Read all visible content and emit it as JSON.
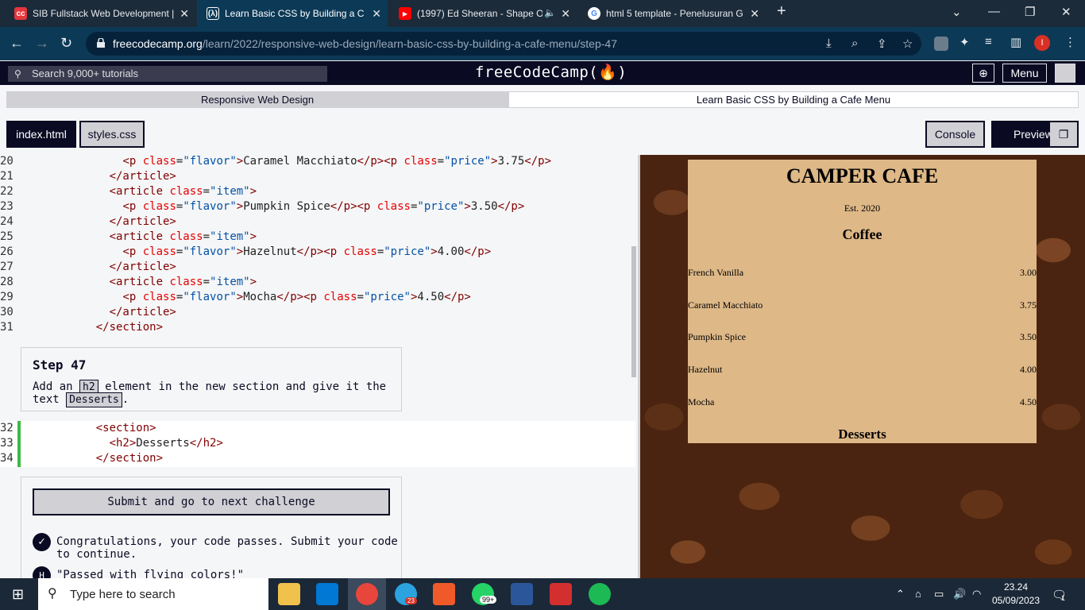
{
  "browser": {
    "tabs": [
      {
        "label": "SIB Fullstack Web Development |",
        "icon": "fcc-red-icon"
      },
      {
        "label": "Learn Basic CSS by Building a Caf",
        "icon": "fcc-icon",
        "active": true
      },
      {
        "label": "(1997) Ed Sheeran - Shape O",
        "icon": "youtube-icon"
      },
      {
        "label": "html 5 template - Penelusuran G",
        "icon": "google-icon"
      }
    ],
    "new_tab": "+",
    "url_host": "freecodecamp.org",
    "url_path": "/learn/2022/responsive-web-design/learn-basic-css-by-building-a-cafe-menu/step-47",
    "profile_initial": "I"
  },
  "fcc": {
    "search_placeholder": "Search 9,000+ tutorials",
    "logo": "freeCodeCamp(🔥)",
    "menu_label": "Menu"
  },
  "breadcrumb": {
    "superblock": "Responsive Web Design",
    "block": "Learn Basic CSS by Building a Cafe Menu"
  },
  "editor_tabs": {
    "index": "index.html",
    "styles": "styles.css",
    "console": "Console",
    "preview": "Preview"
  },
  "code_lines": [
    {
      "n": "20",
      "indent": "      ",
      "html": [
        [
          "tag",
          "<p "
        ],
        [
          "attr",
          "class"
        ],
        [
          "txt",
          "="
        ],
        [
          "val",
          "\"flavor\""
        ],
        [
          "tag",
          ">"
        ],
        [
          "txt",
          "Caramel Macchiato"
        ],
        [
          "tag",
          "</p><p "
        ],
        [
          "attr",
          "class"
        ],
        [
          "txt",
          "="
        ],
        [
          "val",
          "\"price\""
        ],
        [
          "tag",
          ">"
        ],
        [
          "txt",
          "3.75"
        ],
        [
          "tag",
          "</p>"
        ]
      ]
    },
    {
      "n": "21",
      "indent": "    ",
      "html": [
        [
          "tag",
          "</article>"
        ]
      ]
    },
    {
      "n": "22",
      "indent": "    ",
      "html": [
        [
          "tag",
          "<article "
        ],
        [
          "attr",
          "class"
        ],
        [
          "txt",
          "="
        ],
        [
          "val",
          "\"item\""
        ],
        [
          "tag",
          ">"
        ]
      ]
    },
    {
      "n": "23",
      "indent": "      ",
      "html": [
        [
          "tag",
          "<p "
        ],
        [
          "attr",
          "class"
        ],
        [
          "txt",
          "="
        ],
        [
          "val",
          "\"flavor\""
        ],
        [
          "tag",
          ">"
        ],
        [
          "txt",
          "Pumpkin Spice"
        ],
        [
          "tag",
          "</p><p "
        ],
        [
          "attr",
          "class"
        ],
        [
          "txt",
          "="
        ],
        [
          "val",
          "\"price\""
        ],
        [
          "tag",
          ">"
        ],
        [
          "txt",
          "3.50"
        ],
        [
          "tag",
          "</p>"
        ]
      ]
    },
    {
      "n": "24",
      "indent": "    ",
      "html": [
        [
          "tag",
          "</article>"
        ]
      ]
    },
    {
      "n": "25",
      "indent": "    ",
      "html": [
        [
          "tag",
          "<article "
        ],
        [
          "attr",
          "class"
        ],
        [
          "txt",
          "="
        ],
        [
          "val",
          "\"item\""
        ],
        [
          "tag",
          ">"
        ]
      ]
    },
    {
      "n": "26",
      "indent": "      ",
      "html": [
        [
          "tag",
          "<p "
        ],
        [
          "attr",
          "class"
        ],
        [
          "txt",
          "="
        ],
        [
          "val",
          "\"flavor\""
        ],
        [
          "tag",
          ">"
        ],
        [
          "txt",
          "Hazelnut"
        ],
        [
          "tag",
          "</p><p "
        ],
        [
          "attr",
          "class"
        ],
        [
          "txt",
          "="
        ],
        [
          "val",
          "\"price\""
        ],
        [
          "tag",
          ">"
        ],
        [
          "txt",
          "4.00"
        ],
        [
          "tag",
          "</p>"
        ]
      ]
    },
    {
      "n": "27",
      "indent": "    ",
      "html": [
        [
          "tag",
          "</article>"
        ]
      ]
    },
    {
      "n": "28",
      "indent": "    ",
      "html": [
        [
          "tag",
          "<article "
        ],
        [
          "attr",
          "class"
        ],
        [
          "txt",
          "="
        ],
        [
          "val",
          "\"item\""
        ],
        [
          "tag",
          ">"
        ]
      ]
    },
    {
      "n": "29",
      "indent": "      ",
      "html": [
        [
          "tag",
          "<p "
        ],
        [
          "attr",
          "class"
        ],
        [
          "txt",
          "="
        ],
        [
          "val",
          "\"flavor\""
        ],
        [
          "tag",
          ">"
        ],
        [
          "txt",
          "Mocha"
        ],
        [
          "tag",
          "</p><p "
        ],
        [
          "attr",
          "class"
        ],
        [
          "txt",
          "="
        ],
        [
          "val",
          "\"price\""
        ],
        [
          "tag",
          ">"
        ],
        [
          "txt",
          "4.50"
        ],
        [
          "tag",
          "</p>"
        ]
      ]
    },
    {
      "n": "30",
      "indent": "    ",
      "html": [
        [
          "tag",
          "</article>"
        ]
      ]
    },
    {
      "n": "31",
      "indent": "  ",
      "html": [
        [
          "tag",
          "</section>"
        ]
      ]
    }
  ],
  "step": {
    "title": "Step 47",
    "text_before": "Add an",
    "code1": "h2",
    "text_mid": "element in the new section and give it the text",
    "code2": "Desserts",
    "text_after": "."
  },
  "editable_lines": [
    {
      "n": "32",
      "indent": "  ",
      "html": [
        [
          "tag",
          "<section>"
        ]
      ]
    },
    {
      "n": "33",
      "indent": "    ",
      "html": [
        [
          "tag",
          "<h2>"
        ],
        [
          "txt",
          "Desserts"
        ],
        [
          "tag",
          "</h2>"
        ]
      ]
    },
    {
      "n": "34",
      "indent": "  ",
      "html": [
        [
          "tag",
          "</section>"
        ]
      ]
    }
  ],
  "submit": {
    "label": "Submit and go to next challenge",
    "success": "Congratulations, your code passes. Submit your code to continue.",
    "quote": "\"Passed with flying colors!\""
  },
  "preview_menu": {
    "title": "CAMPER CAFE",
    "est": "Est. 2020",
    "section_title": "Coffee",
    "items": [
      {
        "flavor": "French Vanilla",
        "price": "3.00"
      },
      {
        "flavor": "Caramel Macchiato",
        "price": "3.75"
      },
      {
        "flavor": "Pumpkin Spice",
        "price": "3.50"
      },
      {
        "flavor": "Hazelnut",
        "price": "4.00"
      },
      {
        "flavor": "Mocha",
        "price": "4.50"
      }
    ],
    "desserts_title": "Desserts"
  },
  "taskbar": {
    "search_placeholder": "Type here to search",
    "time": "23.24",
    "date": "05/09/2023",
    "notification_count": "1",
    "whatsapp_badge": "99+",
    "telegram_badge": "23"
  }
}
